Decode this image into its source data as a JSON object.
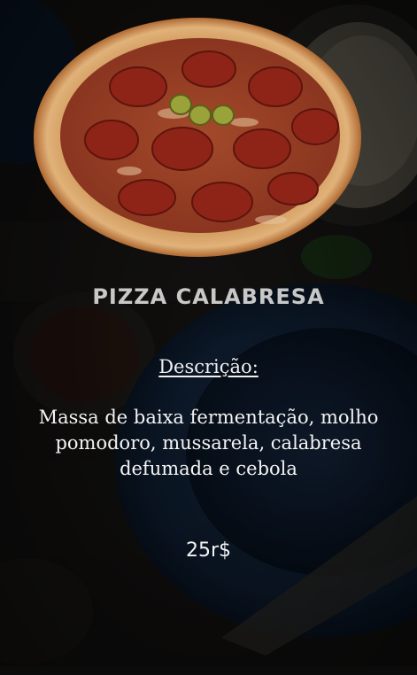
{
  "product": {
    "name": "PIZZA CALABRESA",
    "description_label": "Descrição:",
    "description": "Massa de baixa fermentação, molho pomodoro, mussarela, calabresa defumada e cebola",
    "price": "25r$"
  },
  "colors": {
    "background": "#141414",
    "plate_blue": "#152a44",
    "title": "#c8c8c8",
    "text": "#f4f4f4"
  }
}
